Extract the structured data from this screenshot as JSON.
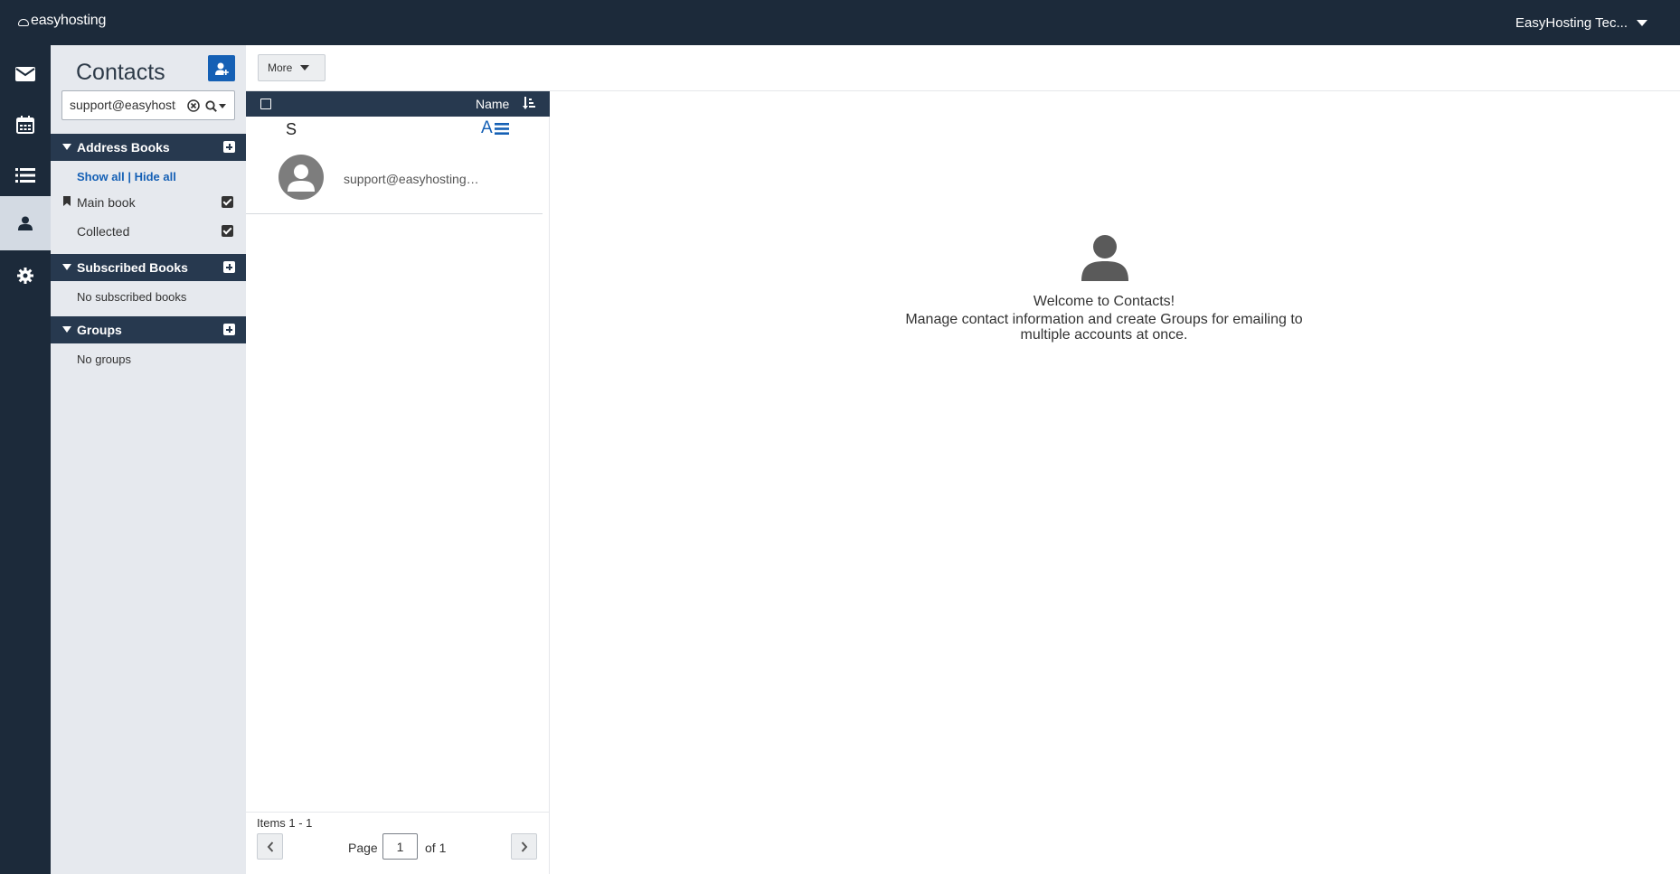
{
  "header": {
    "brand": "easyhosting",
    "account": "EasyHosting Tec..."
  },
  "rail": {
    "items": [
      {
        "icon": "mail-icon"
      },
      {
        "icon": "calendar-icon"
      },
      {
        "icon": "tasks-list-icon"
      },
      {
        "icon": "contacts-icon",
        "active": true
      },
      {
        "icon": "settings-gear-icon"
      }
    ]
  },
  "sidebar": {
    "title": "Contacts",
    "search": {
      "value": "support@easyhosting.com",
      "placeholder": "Search"
    },
    "address_books": {
      "label": "Address Books",
      "show_all": "Show all",
      "separator": " | ",
      "hide_all": "Hide all",
      "books": [
        {
          "name": "Main book",
          "checked": true
        },
        {
          "name": "Collected",
          "checked": true
        }
      ]
    },
    "subscribed_books": {
      "label": "Subscribed Books",
      "empty": "No subscribed books"
    },
    "groups": {
      "label": "Groups",
      "empty": "No groups"
    }
  },
  "toolbar": {
    "more_label": "More"
  },
  "list": {
    "header_name": "Name",
    "letter_group": "S",
    "az_label": "A",
    "contacts": [
      {
        "email": "support@easyhosting.com"
      }
    ],
    "footer": {
      "items": "Items 1 - 1",
      "page_label": "Page",
      "page_value": "1",
      "of_label": "of 1"
    }
  },
  "welcome": {
    "title": "Welcome to Contacts!",
    "description": "Manage contact information and create Groups for emailing to multiple accounts at once."
  },
  "colors": {
    "dark_nav": "#1c2a3a",
    "section_header": "#27394f",
    "accent_blue": "#1560b5",
    "sidebar_bg": "#e6e9ee"
  }
}
